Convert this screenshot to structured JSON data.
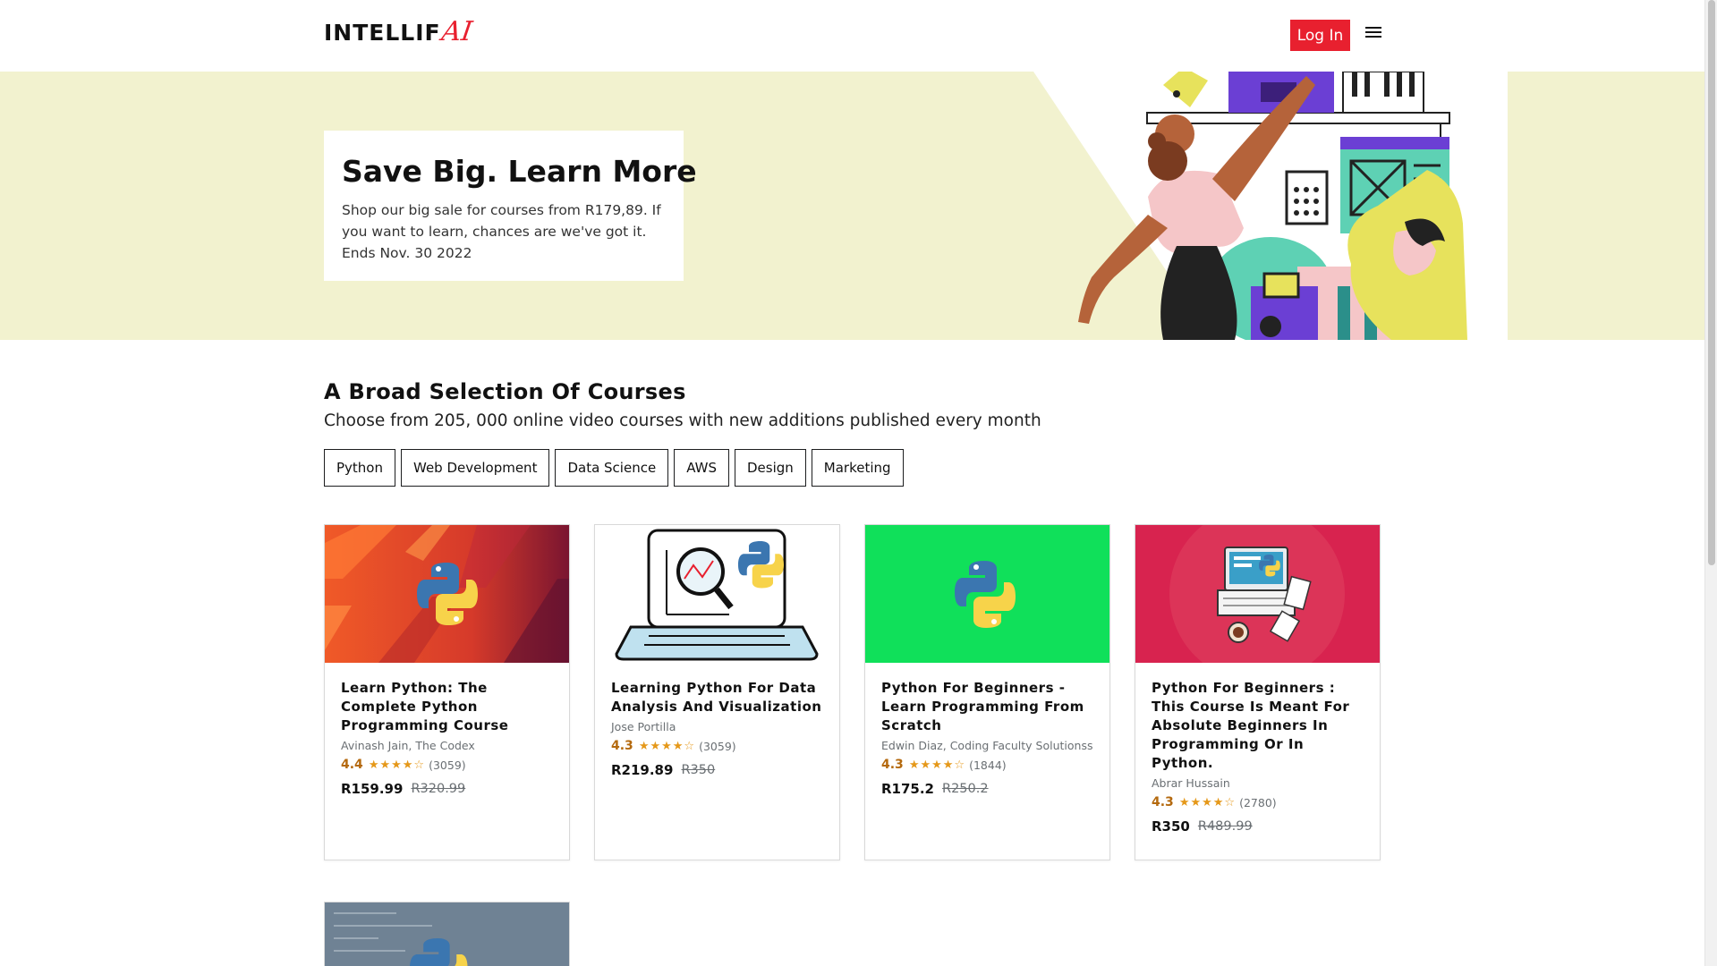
{
  "header": {
    "logo_main": "INTELLIF",
    "logo_ai": "AI",
    "login_label": "Log In",
    "menu_icon": "hamburger-icon"
  },
  "hero": {
    "title": "Save Big. Learn More",
    "text": "Shop our big sale for courses from R179,89. If you want to learn, chances are we've got it. Ends Nov. 30 2022",
    "background": "#f2f2cf"
  },
  "section": {
    "title": "A Broad Selection Of Courses",
    "subtitle": "Choose from 205, 000 online video courses with new additions published every month",
    "chips": [
      "Python",
      "Web Development",
      "Data Science",
      "AWS",
      "Design",
      "Marketing"
    ]
  },
  "courses": [
    {
      "title": "Learn Python: The Complete Python Programming Course",
      "author": "Avinash Jain, The Codex",
      "rating": "4.4",
      "stars": "★★★★☆",
      "count": "(3059)",
      "price": "R159.99",
      "old_price": "R320.99"
    },
    {
      "title": "Learning Python For Data Analysis And Visualization",
      "author": "Jose Portilla",
      "rating": "4.3",
      "stars": "★★★★☆",
      "count": "(3059)",
      "price": "R219.89",
      "old_price": "R350"
    },
    {
      "title": "Python For Beginners - Learn Programming From Scratch",
      "author": "Edwin Diaz, Coding Faculty Solutionss",
      "rating": "4.3",
      "stars": "★★★★☆",
      "count": "(1844)",
      "price": "R175.2",
      "old_price": "R250.2"
    },
    {
      "title": "Python For Beginners : This Course Is Meant For Absolute Beginners In Programming Or In Python.",
      "author": "Abrar Hussain",
      "rating": "4.3",
      "stars": "★★★★☆",
      "count": "(2780)",
      "price": "R350",
      "old_price": "R489.99"
    }
  ],
  "colors": {
    "accent": "#e8202f",
    "rating": "#b4690e",
    "star": "#e59819"
  }
}
